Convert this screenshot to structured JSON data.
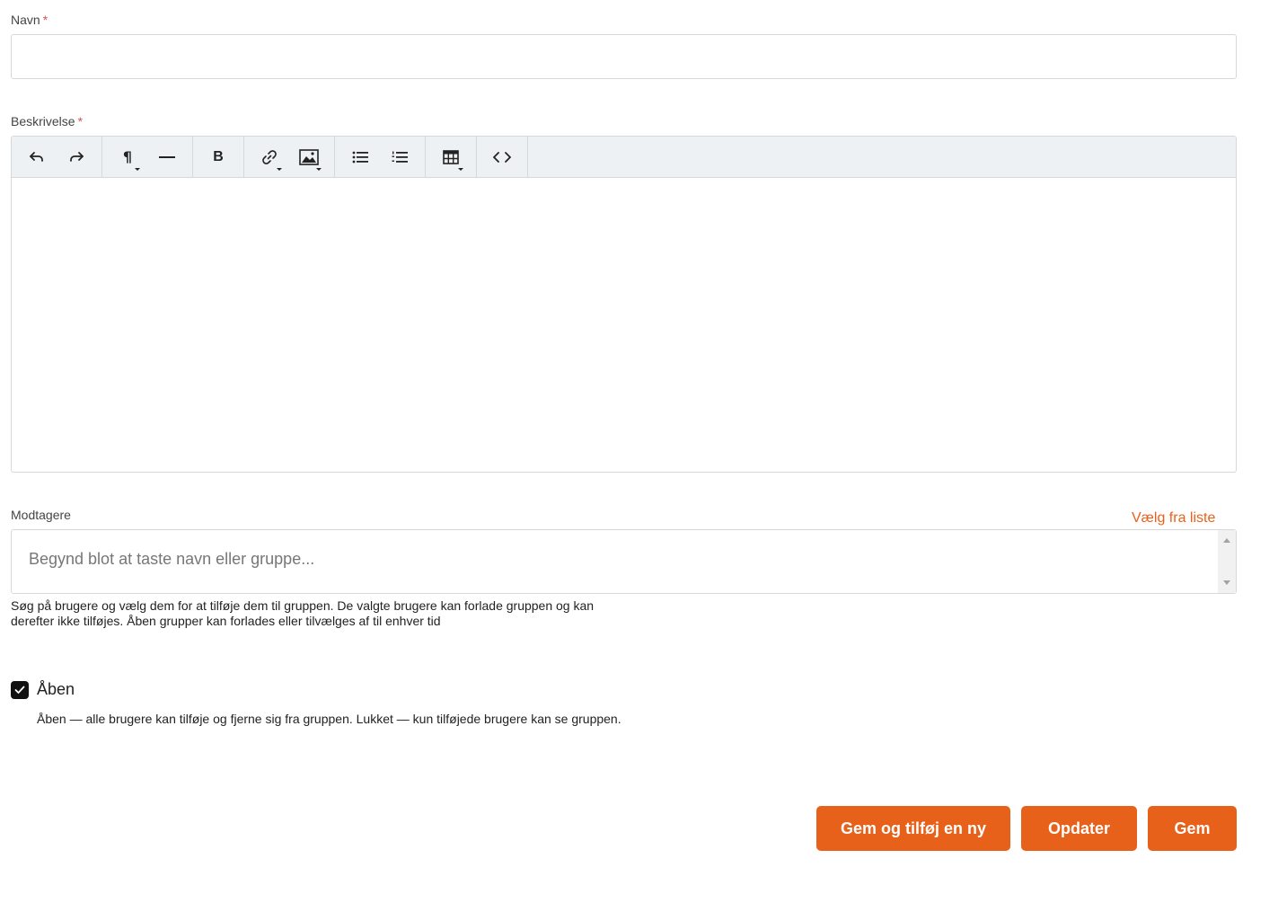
{
  "form": {
    "name": {
      "label": "Navn",
      "required_mark": "*",
      "value": ""
    },
    "description": {
      "label": "Beskrivelse",
      "required_mark": "*",
      "toolbar": [
        [
          "undo-icon",
          "redo-icon"
        ],
        [
          "paragraph-icon",
          "horizontal-rule-icon"
        ],
        [
          "bold-icon"
        ],
        [
          "link-icon",
          "image-icon"
        ],
        [
          "bullet-list-icon",
          "numbered-list-icon"
        ],
        [
          "table-icon"
        ],
        [
          "code-icon"
        ]
      ]
    },
    "recipients": {
      "label": "Modtagere",
      "pick_link": "Vælg fra liste",
      "placeholder": "Begynd blot at taste navn eller gruppe...",
      "help": "Søg på brugere og vælg dem for at tilføje dem til gruppen. De valgte brugere kan forlade gruppen og kan derefter ikke tilføjes. Åben grupper kan forlades eller tilvælges af til enhver tid"
    },
    "open": {
      "checked": true,
      "label": "Åben",
      "description": "Åben — alle brugere kan tilføje og fjerne sig fra gruppen. Lukket — kun tilføjede brugere kan se gruppen."
    }
  },
  "buttons": {
    "save_and_new": "Gem og tilføj en ny",
    "update": "Opdater",
    "save": "Gem"
  },
  "colors": {
    "accent": "#e8611a",
    "toolbar_bg": "#eef1f3",
    "border": "#d6d9dc",
    "required": "#d9534f"
  }
}
